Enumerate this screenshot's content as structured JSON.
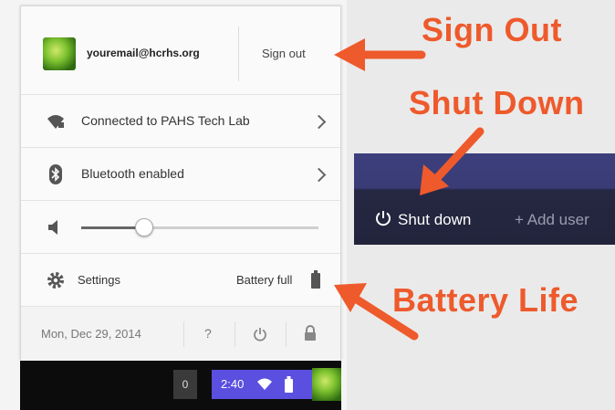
{
  "account": {
    "email": "youremail@hcrhs.org",
    "sign_out_label": "Sign out"
  },
  "network": {
    "label": "Connected to PAHS Tech Lab",
    "icon": "wifi-icon"
  },
  "bluetooth": {
    "label": "Bluetooth enabled",
    "icon": "bluetooth-icon"
  },
  "volume": {
    "level": 0.26,
    "icon": "speaker-icon"
  },
  "settings": {
    "label": "Settings",
    "battery_label": "Battery full",
    "icon": "gear-icon"
  },
  "footer": {
    "date": "Mon, Dec 29, 2014",
    "help": "?"
  },
  "shelf": {
    "notification_count": "0",
    "time": "2:40"
  },
  "login_bar": {
    "shutdown_label": "Shut down",
    "add_user_label": "+ Add user"
  },
  "callouts": {
    "sign_out": "Sign Out",
    "shut_down": "Shut Down",
    "battery": "Battery Life"
  },
  "colors": {
    "accent": "#ee5a2c",
    "shelf_status": "#5b4fe0"
  }
}
